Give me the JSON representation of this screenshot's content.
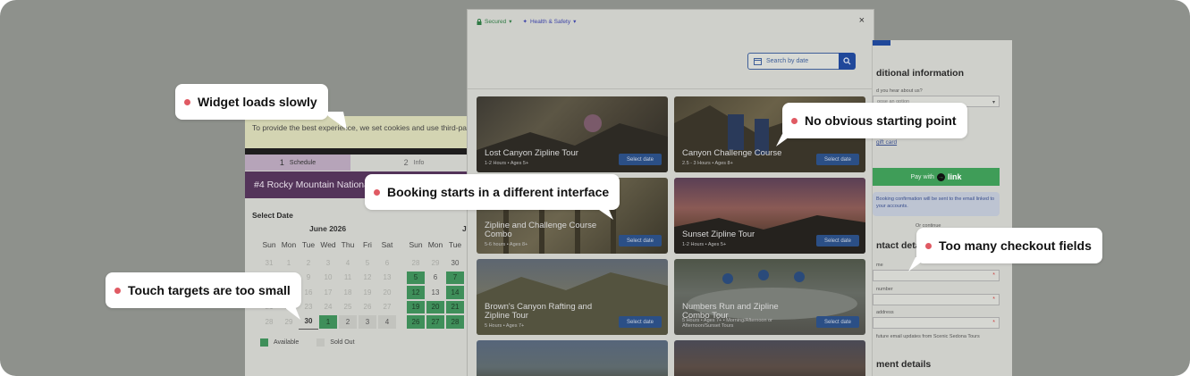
{
  "colors": {
    "background": "#8e918c",
    "available": "#3f8f5a",
    "sold_out": "#c2c3be",
    "brand_blue": "#20489a",
    "pay_green": "#3f9d58",
    "callout_dot": "#e05a63"
  },
  "booking_widget": {
    "cookie_text": "To provide the best experience, we set cookies and use third-party",
    "steps": [
      {
        "num": "1",
        "label": "Schedule"
      },
      {
        "num": "2",
        "label": "Info"
      }
    ],
    "event_title": "#4 Rocky Mountain National",
    "select_date_label": "Select Date",
    "month1": {
      "title": "June 2026",
      "days_of_week": [
        "Sun",
        "Mon",
        "Tue",
        "Wed",
        "Thu",
        "Fri",
        "Sat"
      ],
      "rows": [
        [
          "31",
          "1",
          "2",
          "3",
          "4",
          "5",
          "6"
        ],
        [
          "7",
          "8",
          "9",
          "10",
          "11",
          "12",
          "13"
        ],
        [
          "14",
          "15",
          "16",
          "17",
          "18",
          "19",
          "20"
        ],
        [
          "21",
          "22",
          "23",
          "24",
          "25",
          "26",
          "27"
        ],
        [
          "28",
          "29",
          "30",
          "1",
          "2",
          "3",
          "4"
        ]
      ]
    },
    "month2": {
      "title": "Ju",
      "days_of_week": [
        "Sun",
        "Mon",
        "Tue"
      ],
      "rows": [
        [
          "28",
          "29",
          "30"
        ],
        [
          "5",
          "6",
          "7"
        ],
        [
          "12",
          "13",
          "14"
        ],
        [
          "19",
          "20",
          "21"
        ],
        [
          "26",
          "27",
          "28"
        ]
      ]
    },
    "legend": {
      "available": "Available",
      "sold_out": "Sold Out"
    }
  },
  "tour_modal": {
    "secured_label": "Secured",
    "health_label": "Health & Safety",
    "close_glyph": "×",
    "search_placeholder": "Search by date",
    "tours": [
      {
        "title": "Lost Canyon Zipline Tour",
        "sub": "1-2 Hours • Ages 5+",
        "button": "Select date"
      },
      {
        "title": "Canyon Challenge Course",
        "sub": "2.5 - 3 Hours • Ages 8+",
        "button": "Select date"
      },
      {
        "title": "Zipline and Challenge Course Combo",
        "sub": "5-6 hours • Ages 8+",
        "button": "Select date"
      },
      {
        "title": "Sunset Zipline Tour",
        "sub": "1-2 Hours • Ages 5+",
        "button": "Select date"
      },
      {
        "title": "Brown's Canyon Rafting and Zipline Tour",
        "sub": "5 Hours • Ages 7+",
        "button": "Select date"
      },
      {
        "title": "Numbers Run and Zipline Combo Tour",
        "sub": "5 Hours • Ages 7+ • Morning/Afternoon or Afternoon/Sunset Tours",
        "button": "Select date"
      }
    ]
  },
  "checkout": {
    "additional_info_heading": "ditional information",
    "hear_label": "d you hear about us?",
    "select_placeholder": "oose an option",
    "gift_card_link": "gift card",
    "pay_with": "Pay with",
    "pay_brand": "link",
    "info_text": "Booking confirmation will be sent to the email linked to your accounts.",
    "or_text": "Or continue",
    "contact_heading": "ntact details",
    "fields": [
      {
        "label": "me",
        "value": ""
      },
      {
        "label": "number",
        "value": ""
      },
      {
        "label": "address",
        "value": ""
      }
    ],
    "updates_text": "future email updates from Scenic Sedona Tours",
    "payment_heading": "ment details"
  },
  "callouts": [
    {
      "text": "Widget loads slowly"
    },
    {
      "text": "No obvious starting point"
    },
    {
      "text": "Booking starts in a different interface"
    },
    {
      "text": "Too many checkout fields"
    },
    {
      "text": "Touch targets are too small"
    }
  ]
}
